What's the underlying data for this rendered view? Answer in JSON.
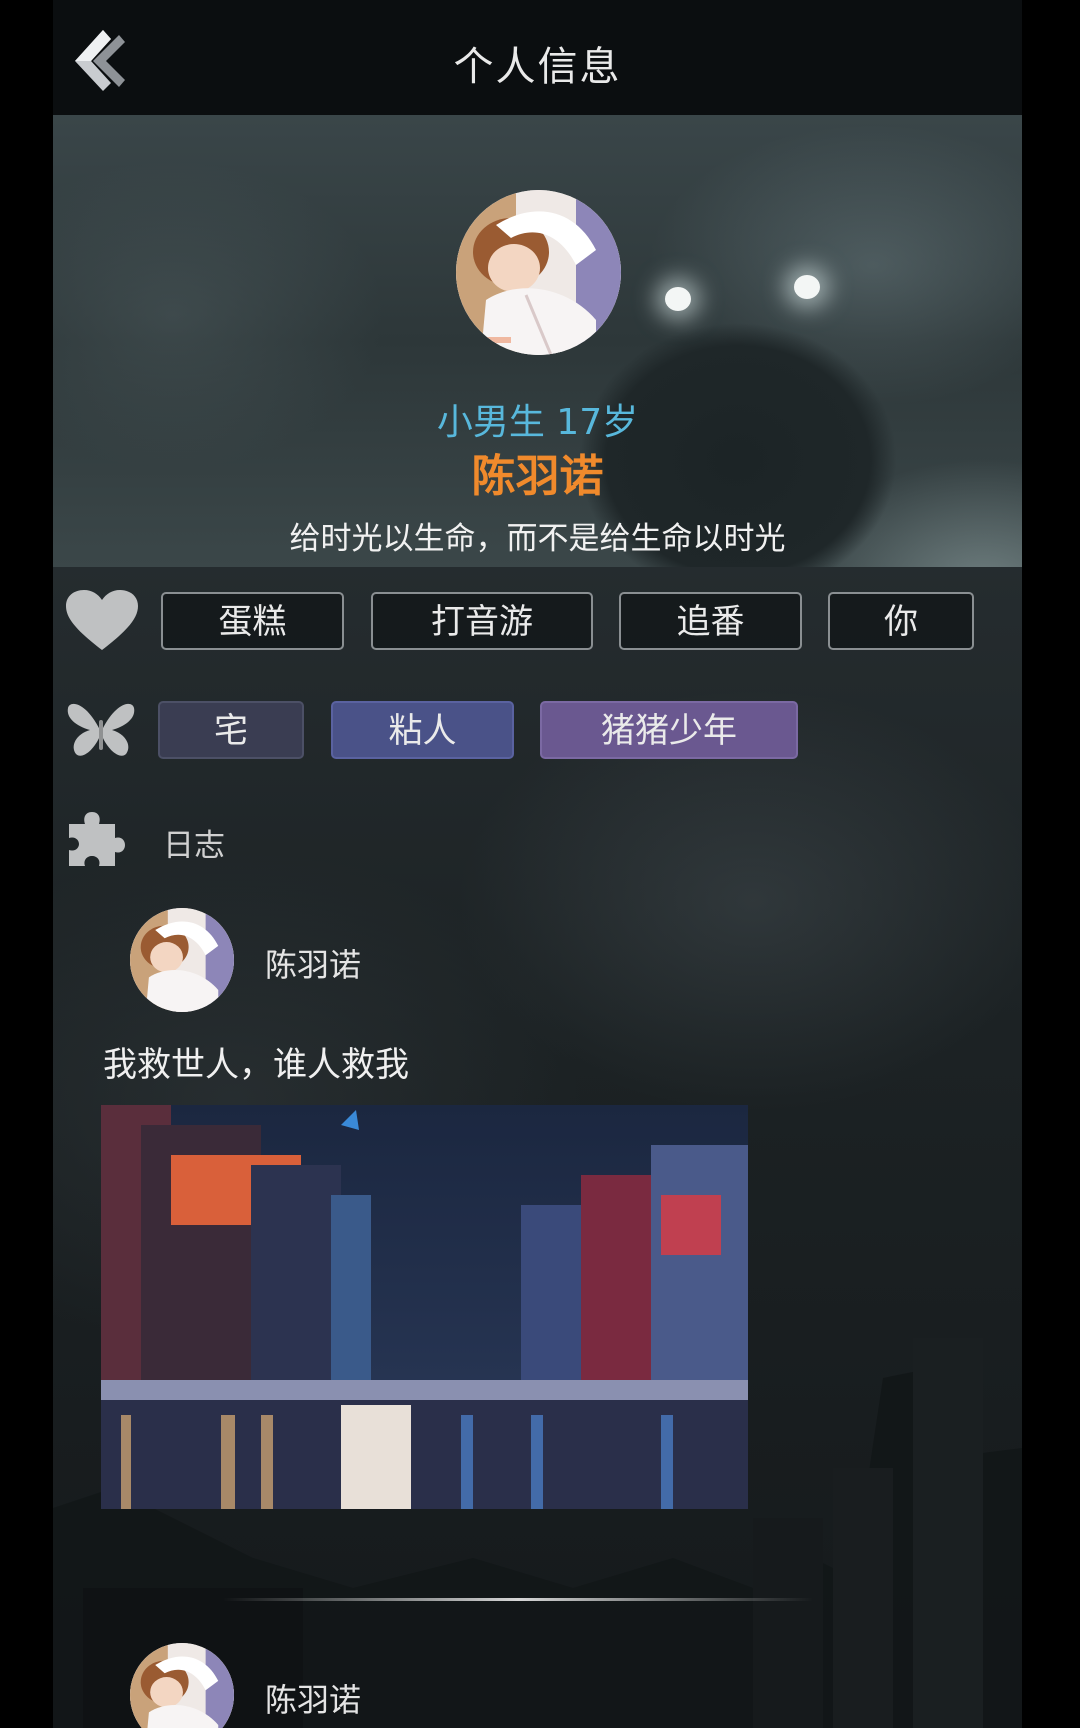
{
  "header": {
    "title": "个人信息"
  },
  "profile": {
    "gender_age": "小男生 17岁",
    "name": "陈羽诺",
    "motto": "给时光以生命，而不是给生命以时光"
  },
  "hobbies": [
    "蛋糕",
    "打音游",
    "追番",
    "你"
  ],
  "traits": [
    "宅",
    "粘人",
    "猪猪少年"
  ],
  "log_section": {
    "label": "日志"
  },
  "posts": [
    {
      "author": "陈羽诺",
      "text": "我救世人，谁人救我"
    },
    {
      "author": "陈羽诺",
      "text": ""
    }
  ],
  "icons": {
    "back": "back-chevron-icon",
    "hobbies": "heart-icon",
    "traits": "butterfly-icon",
    "log": "puzzle-icon"
  },
  "colors": {
    "name": "#f08a2c",
    "gender_age": "#58b8dc",
    "trait_1": "#3a3d52",
    "trait_2": "#4a5288",
    "trait_3": "#6a5890"
  }
}
